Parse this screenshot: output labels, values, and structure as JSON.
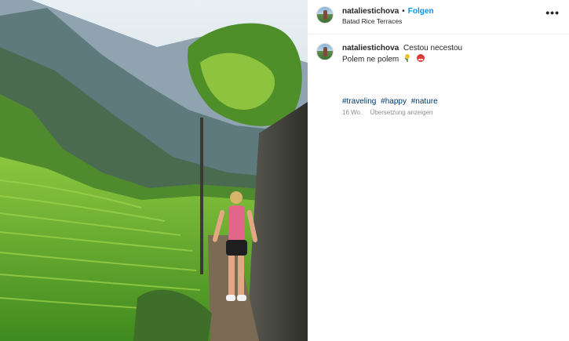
{
  "post": {
    "username": "nataliestichova",
    "dot": "•",
    "follow_label": "Folgen",
    "location": "Batad Rice Terraces",
    "more_label": "•••"
  },
  "comment": {
    "username": "nataliestichova",
    "text_line1": "Cestou necestou",
    "text_line2": "Polem ne polem",
    "hashtags": [
      "#traveling",
      "#happy",
      "#nature"
    ],
    "time": "16 Wo.",
    "translate_label": "Übersetzung anzeigen"
  },
  "colors": {
    "link": "#0095f6",
    "hashtag": "#00376b",
    "muted": "#8e8e8e"
  },
  "icons": {
    "more": "more-options-icon",
    "emoji1": "sun-with-plant-emoji",
    "emoji2": "red-heart-emoji"
  }
}
